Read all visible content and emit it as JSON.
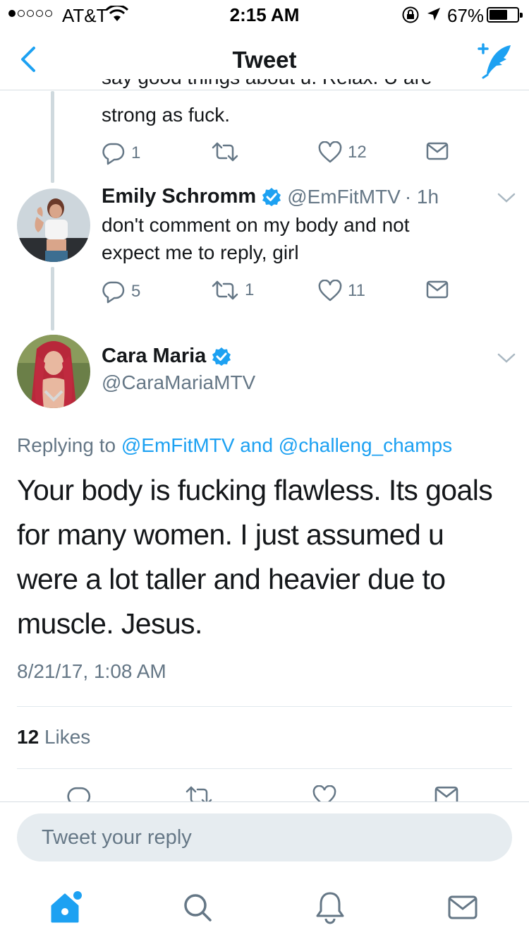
{
  "status_bar": {
    "carrier": "AT&T",
    "time": "2:15 AM",
    "battery_percent": "67%",
    "battery_level": 0.67
  },
  "nav": {
    "title": "Tweet"
  },
  "previous_tweet": {
    "text_hidden": "say good things about u. Relax. U are",
    "text_visible": "strong as fuck.",
    "replies": "1",
    "retweets": "",
    "likes": "12"
  },
  "emily_tweet": {
    "name": "Emily Schromm",
    "handle": "@EmFitMTV",
    "time": "· 1h",
    "text_line1": "don't comment on my body and not",
    "text_line2": "expect me to reply, girl",
    "replies": "5",
    "retweets": "1",
    "likes": "11"
  },
  "main_tweet": {
    "name": "Cara Maria",
    "handle": "@CaraMariaMTV",
    "replying_prefix": "Replying to ",
    "replying_to_1": "@EmFitMTV",
    "replying_and": " and ",
    "replying_to_2": "@challeng_champs",
    "text_line1": "Your body is fucking flawless. Its goals",
    "text_line2": "for many women. I just assumed u",
    "text_line3": "were a lot taller and heavier due to",
    "text_line4": "muscle. Jesus.",
    "timestamp": "8/21/17, 1:08 AM",
    "likes_count": "12",
    "likes_label": "Likes"
  },
  "reply_bar": {
    "placeholder": "Tweet your reply"
  },
  "colors": {
    "accent": "#1da1f2",
    "muted": "#657786",
    "text": "#14171a"
  },
  "icons": [
    "back-chevron-icon",
    "compose-tweet-icon",
    "reply-icon",
    "retweet-icon",
    "like-heart-icon",
    "direct-message-icon",
    "verified-badge-icon",
    "caret-down-icon",
    "home-icon",
    "search-icon",
    "notifications-bell-icon",
    "messages-envelope-icon"
  ]
}
